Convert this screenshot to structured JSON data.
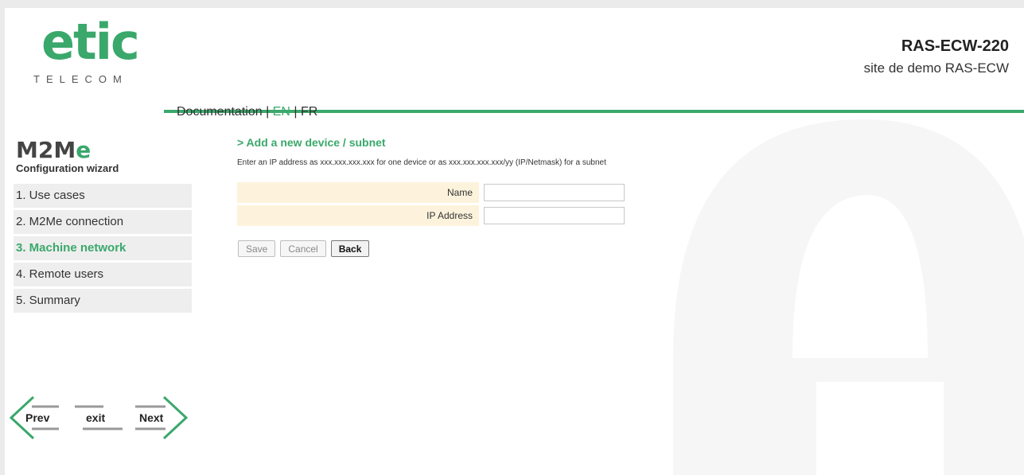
{
  "brand": {
    "logo_main": "etic",
    "logo_sub": "TELECOM",
    "accent": "#3aa86b"
  },
  "product": {
    "model": "RAS-ECW-220",
    "site": "site de demo RAS-ECW"
  },
  "doc_links": {
    "documentation": "Documentation",
    "sep1": " | ",
    "en": "EN",
    "sep2": " | ",
    "fr": "FR"
  },
  "wizard": {
    "title_prefix": "M2M",
    "title_e": "e",
    "subtitle": "Configuration wizard",
    "steps": [
      {
        "label": "1. Use cases"
      },
      {
        "label": "2. M2Me connection"
      },
      {
        "label": "3. Machine network",
        "active": true
      },
      {
        "label": "4. Remote users"
      },
      {
        "label": "5. Summary"
      }
    ]
  },
  "page": {
    "heading": "> Add a new device / subnet",
    "hint": "Enter an IP address as xxx.xxx.xxx.xxx for one device or as xxx.xxx.xxx.xxx/yy (IP/Netmask) for a subnet"
  },
  "form": {
    "name_label": "Name",
    "name_value": "",
    "ip_label": "IP Address",
    "ip_value": ""
  },
  "buttons": {
    "save": "Save",
    "cancel": "Cancel",
    "back": "Back"
  },
  "nav": {
    "prev": "Prev",
    "exit": "exit",
    "next": "Next"
  }
}
